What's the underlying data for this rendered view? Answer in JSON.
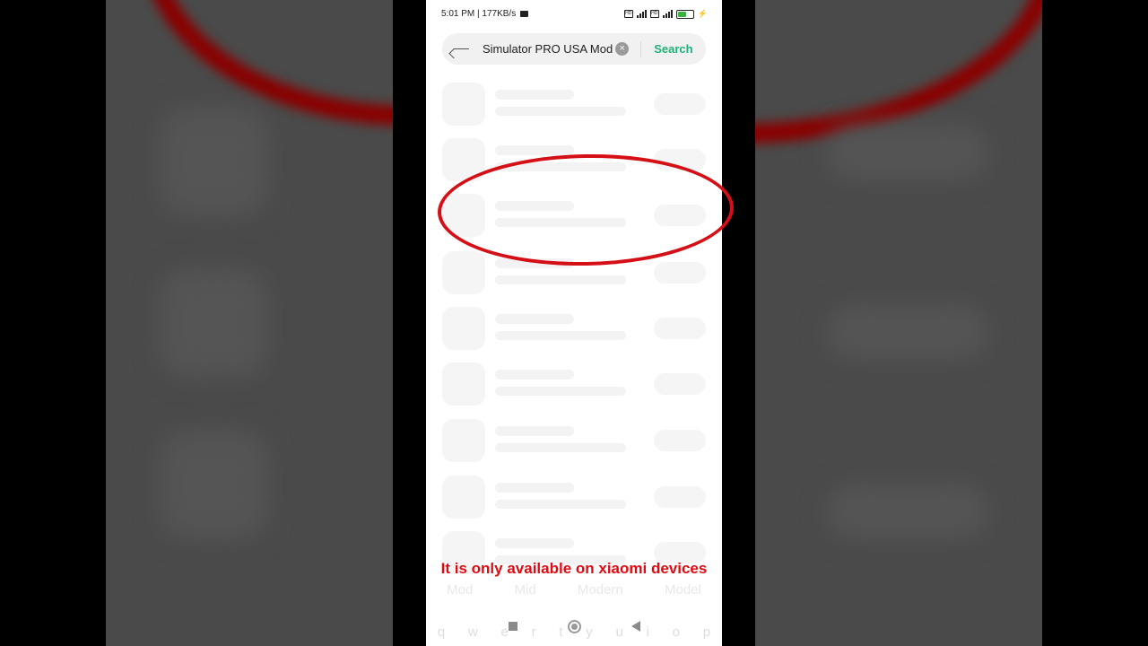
{
  "status_bar": {
    "time_speed": "5:01 PM | 177KB/s",
    "sim1": "HD",
    "sim2": "HD"
  },
  "search": {
    "query": "Simulator PRO USA Mod",
    "button_label": "Search"
  },
  "keyboard_suggestions": [
    "Mod",
    "Mid",
    "Modern",
    "Model"
  ],
  "keyboard_keys": [
    "q",
    "w",
    "e",
    "r",
    "t",
    "y",
    "u",
    "i",
    "o",
    "p"
  ],
  "caption": "It is only available on xiaomi devices",
  "colors": {
    "accent": "#21b07a",
    "annotation_red": "#d40f16"
  }
}
